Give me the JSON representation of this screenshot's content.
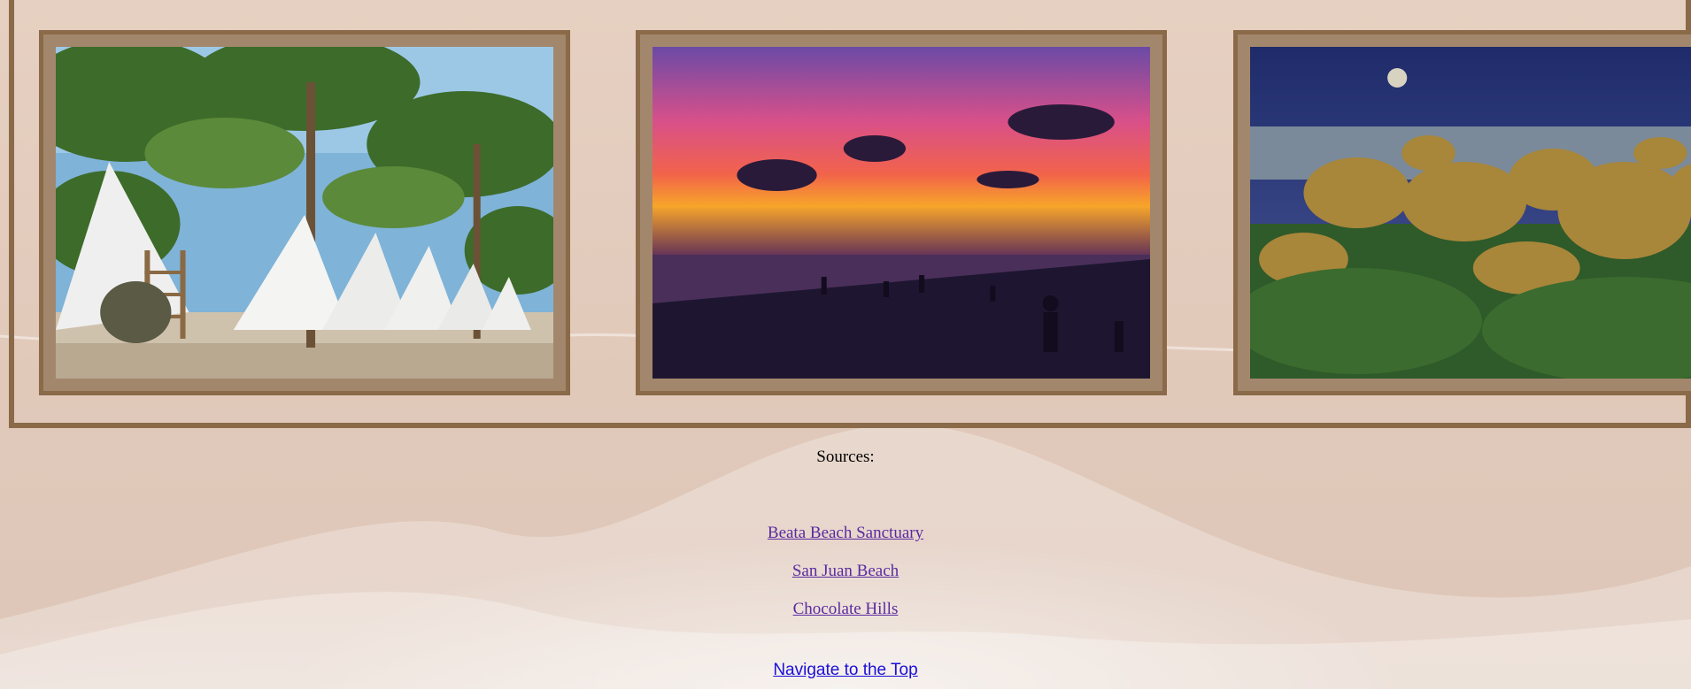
{
  "gallery": {
    "images": [
      {
        "subject": "Beach huts under palm trees"
      },
      {
        "subject": "Sunset over a beach with silhouetted people"
      },
      {
        "subject": "Chocolate Hills under a night sky with moon"
      }
    ]
  },
  "sources": {
    "heading": "Sources:",
    "links": [
      {
        "label": "Beata Beach Sanctuary"
      },
      {
        "label": "San Juan Beach"
      },
      {
        "label": "Chocolate Hills"
      }
    ]
  },
  "nav": {
    "top_label": "Navigate to the Top"
  },
  "colors": {
    "frame_border": "#8a6a48",
    "frame_mat": "#a3876c",
    "visited_link": "#5a2aa0",
    "link": "#1a10d8"
  }
}
